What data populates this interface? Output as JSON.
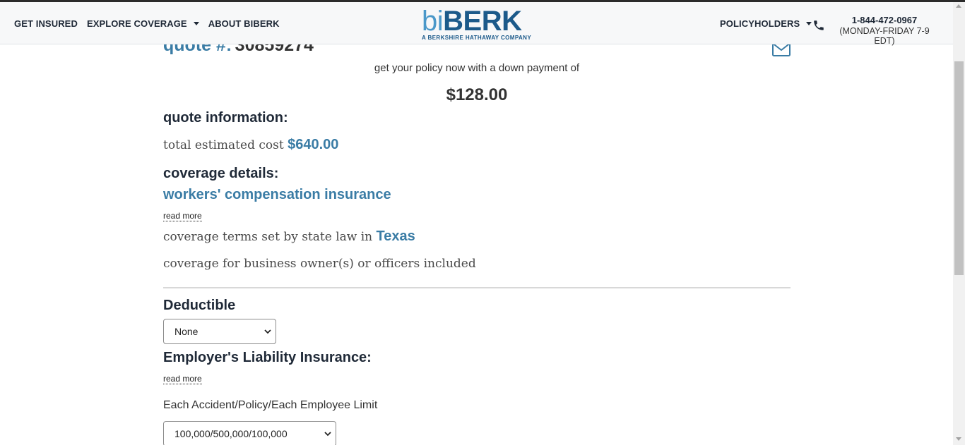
{
  "nav": {
    "items": [
      {
        "label": "GET INSURED",
        "has_caret": false
      },
      {
        "label": "EXPLORE COVERAGE",
        "has_caret": true
      },
      {
        "label": "ABOUT BIBERK",
        "has_caret": false
      }
    ],
    "policyholders_label": "POLICYHOLDERS",
    "phone_number": "1-844-472-0967",
    "phone_hours": "(MONDAY-FRIDAY 7-9 EDT)"
  },
  "logo": {
    "bi": "bi",
    "berk": "BERK",
    "tagline": "A BERKSHIRE HATHAWAY COMPANY"
  },
  "quote": {
    "label": "quote #:",
    "number": "30859274",
    "down_payment_text": "get your policy now with a down payment of",
    "down_payment_amount": "$128.00"
  },
  "quote_info": {
    "heading": "quote information:",
    "total_cost_label": "total estimated cost",
    "total_cost_value": "$640.00"
  },
  "coverage": {
    "heading": "coverage details:",
    "insurance_type": "workers' compensation insurance",
    "read_more": "read more",
    "state_text": "coverage terms set by state law in",
    "state": "Texas",
    "owners_text": "coverage for business owner(s) or officers included"
  },
  "deductible": {
    "heading": "Deductible",
    "selected": "None"
  },
  "employers_liability": {
    "heading": "Employer's Liability Insurance:",
    "read_more": "read more",
    "limit_label": "Each Accident/Policy/Each Employee Limit",
    "selected": "100,000/500,000/100,000"
  },
  "colors": {
    "accent": "#3a7ca5",
    "logo_dark": "#1c5a8a",
    "logo_light": "#4a98c9",
    "text_dark": "#1f2937"
  }
}
